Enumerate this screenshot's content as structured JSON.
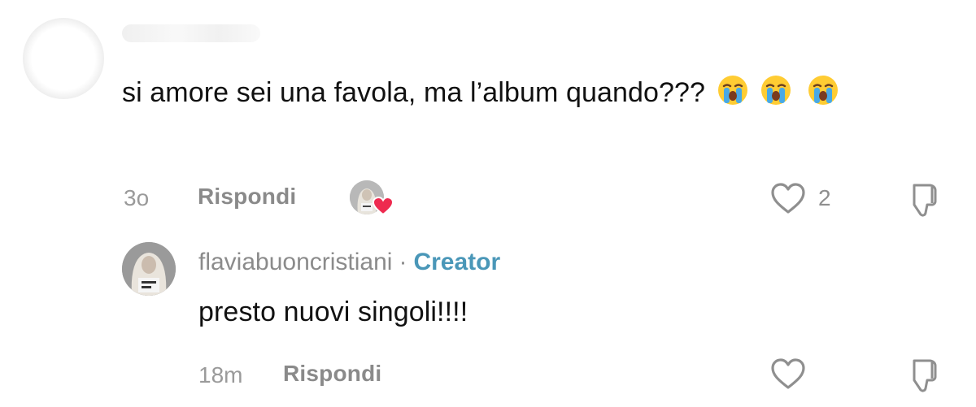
{
  "comment": {
    "text": "si amore sei una favola, ma l’album quando???",
    "emoji_icon": "loudly-crying-face-icon",
    "time": "3o",
    "reply_label": "Rispondi",
    "like_count": "2"
  },
  "reply": {
    "username": "flaviabuoncristiani",
    "separator": "·",
    "badge": "Creator",
    "text": "presto nuovi singoli!!!!",
    "time": "18m",
    "reply_label": "Rispondi"
  },
  "colors": {
    "creator_badge": "#4a97b8",
    "heart_badge": "#ee2a4f",
    "muted_text": "#8b8b8b"
  }
}
